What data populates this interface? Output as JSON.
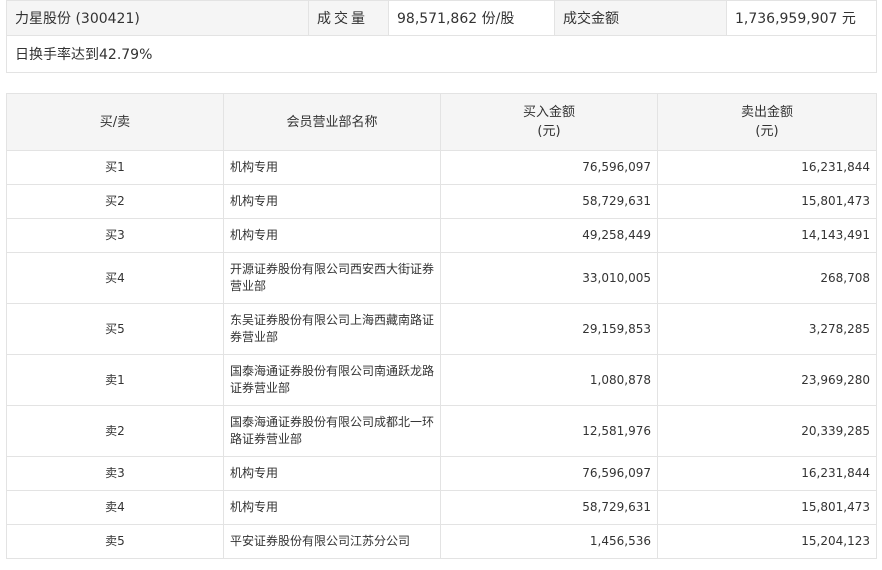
{
  "summary": {
    "stock": "力星股份 (300421)",
    "volume_label": "成交量",
    "volume_value": "98,571,862 份/股",
    "amount_label": "成交金额",
    "amount_value": "1,736,959,907 元",
    "note": "日换手率达到42.79%"
  },
  "table": {
    "headers": {
      "side": "买/卖",
      "name": "会员营业部名称",
      "buy_line1": "买入金额",
      "buy_line2": "(元)",
      "sell_line1": "卖出金额",
      "sell_line2": "(元)"
    },
    "rows": [
      {
        "side": "买1",
        "name": "机构专用",
        "buy": "76,596,097",
        "sell": "16,231,844"
      },
      {
        "side": "买2",
        "name": "机构专用",
        "buy": "58,729,631",
        "sell": "15,801,473"
      },
      {
        "side": "买3",
        "name": "机构专用",
        "buy": "49,258,449",
        "sell": "14,143,491"
      },
      {
        "side": "买4",
        "name": "开源证券股份有限公司西安西大街证券营业部",
        "buy": "33,010,005",
        "sell": "268,708"
      },
      {
        "side": "买5",
        "name": "东吴证券股份有限公司上海西藏南路证券营业部",
        "buy": "29,159,853",
        "sell": "3,278,285"
      },
      {
        "side": "卖1",
        "name": "国泰海通证券股份有限公司南通跃龙路证券营业部",
        "buy": "1,080,878",
        "sell": "23,969,280"
      },
      {
        "side": "卖2",
        "name": "国泰海通证券股份有限公司成都北一环路证券营业部",
        "buy": "12,581,976",
        "sell": "20,339,285"
      },
      {
        "side": "卖3",
        "name": "机构专用",
        "buy": "76,596,097",
        "sell": "16,231,844"
      },
      {
        "side": "卖4",
        "name": "机构专用",
        "buy": "58,729,631",
        "sell": "15,801,473"
      },
      {
        "side": "卖5",
        "name": "平安证券股份有限公司江苏分公司",
        "buy": "1,456,536",
        "sell": "15,204,123"
      }
    ]
  }
}
